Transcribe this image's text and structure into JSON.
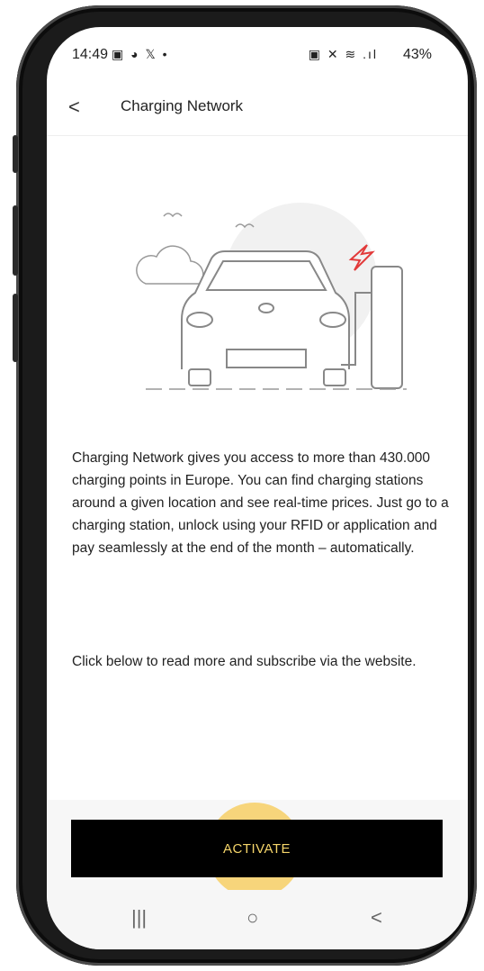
{
  "status_bar": {
    "time": "14:49",
    "left_icons": [
      "gallery-icon",
      "chat-icon",
      "x-icon",
      "dot"
    ],
    "left_text": "▣ ◕ 𝕏 •",
    "right_text": "▣ ✕ ≋ .ıl",
    "battery": "43%"
  },
  "header": {
    "back": "<",
    "title": "Charging Network"
  },
  "content": {
    "description": "Charging Network gives you access to more than 430.000 charging points in Europe. You can find charging stations around a given location and see real-time prices. Just go to a charging station, unlock using your RFID or application and pay seamlessly at the end of the month – automatically.",
    "instruction": "Click below to read more and subscribe via the website."
  },
  "actions": {
    "activate": "ACTIVATE"
  },
  "nav": {
    "recent": "|||",
    "home": "○",
    "back": "<"
  },
  "colors": {
    "button_bg": "#000000",
    "button_text": "#f5d56a",
    "highlight": "#f7be28",
    "bolt": "#e23a3a"
  }
}
